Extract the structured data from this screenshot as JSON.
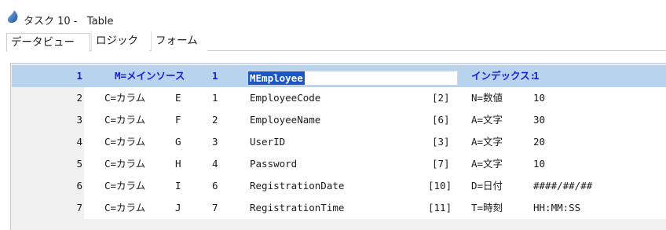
{
  "window": {
    "title": "タスク 10 -   Table"
  },
  "tabs": [
    {
      "label": "データビュー"
    },
    {
      "label": "ロジック"
    },
    {
      "label": "フォーム"
    }
  ],
  "rows": [
    {
      "no": "1",
      "kind": "M=メインソース",
      "letter": "",
      "idx": "1",
      "name": "MEmployee",
      "ref": "",
      "type": "インデックス:",
      "format": "1"
    },
    {
      "no": "2",
      "kind": "C=カラム",
      "letter": "E",
      "idx": "1",
      "name": "EmployeeCode",
      "ref": "[2]",
      "type": "N=数値",
      "format": "10"
    },
    {
      "no": "3",
      "kind": "C=カラム",
      "letter": "F",
      "idx": "2",
      "name": "EmployeeName",
      "ref": "[6]",
      "type": "A=文字",
      "format": "30"
    },
    {
      "no": "4",
      "kind": "C=カラム",
      "letter": "G",
      "idx": "3",
      "name": "UserID",
      "ref": "[3]",
      "type": "A=文字",
      "format": "20"
    },
    {
      "no": "5",
      "kind": "C=カラム",
      "letter": "H",
      "idx": "4",
      "name": "Password",
      "ref": "[7]",
      "type": "A=文字",
      "format": "10"
    },
    {
      "no": "6",
      "kind": "C=カラム",
      "letter": "I",
      "idx": "6",
      "name": "RegistrationDate",
      "ref": "[10]",
      "type": "D=日付",
      "format": "####/##/##"
    },
    {
      "no": "7",
      "kind": "C=カラム",
      "letter": "J",
      "idx": "7",
      "name": "RegistrationTime",
      "ref": "[11]",
      "type": "T=時刻",
      "format": "HH:MM:SS"
    }
  ],
  "colors": {
    "selected_row": "#b8d3ee",
    "selected_text": "#1b1bd6",
    "highlight": "#1c56c6"
  }
}
